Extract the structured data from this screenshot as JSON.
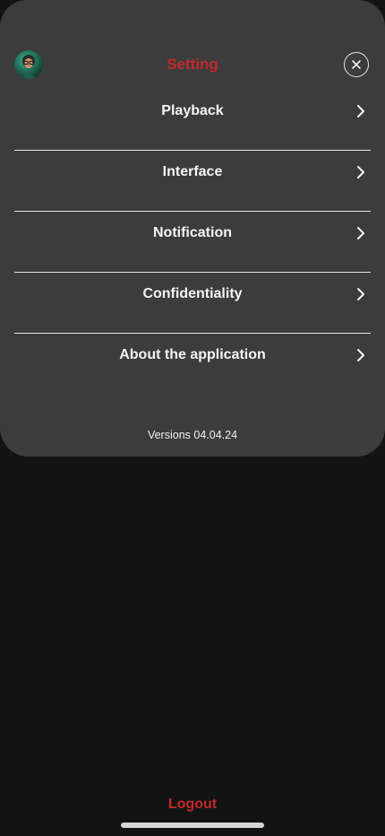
{
  "header": {
    "title": "Setting",
    "title_color": "#c4272b",
    "avatar_icon": "user-avatar",
    "close_icon": "close-icon"
  },
  "menu": {
    "items": [
      {
        "label": "Playback",
        "icon": "chevron-right-icon"
      },
      {
        "label": "Interface",
        "icon": "chevron-right-icon"
      },
      {
        "label": "Notification",
        "icon": "chevron-right-icon"
      },
      {
        "label": "Confidentiality",
        "icon": "chevron-right-icon"
      },
      {
        "label": "About the application",
        "icon": "chevron-right-icon"
      }
    ]
  },
  "footer": {
    "version": "Versions 04.04.24",
    "logout_label": "Logout",
    "logout_color": "#c4272b"
  },
  "colors": {
    "background": "#131313",
    "panel": "#3c3c3c",
    "text": "#f4f4f4",
    "accent": "#c4272b"
  }
}
